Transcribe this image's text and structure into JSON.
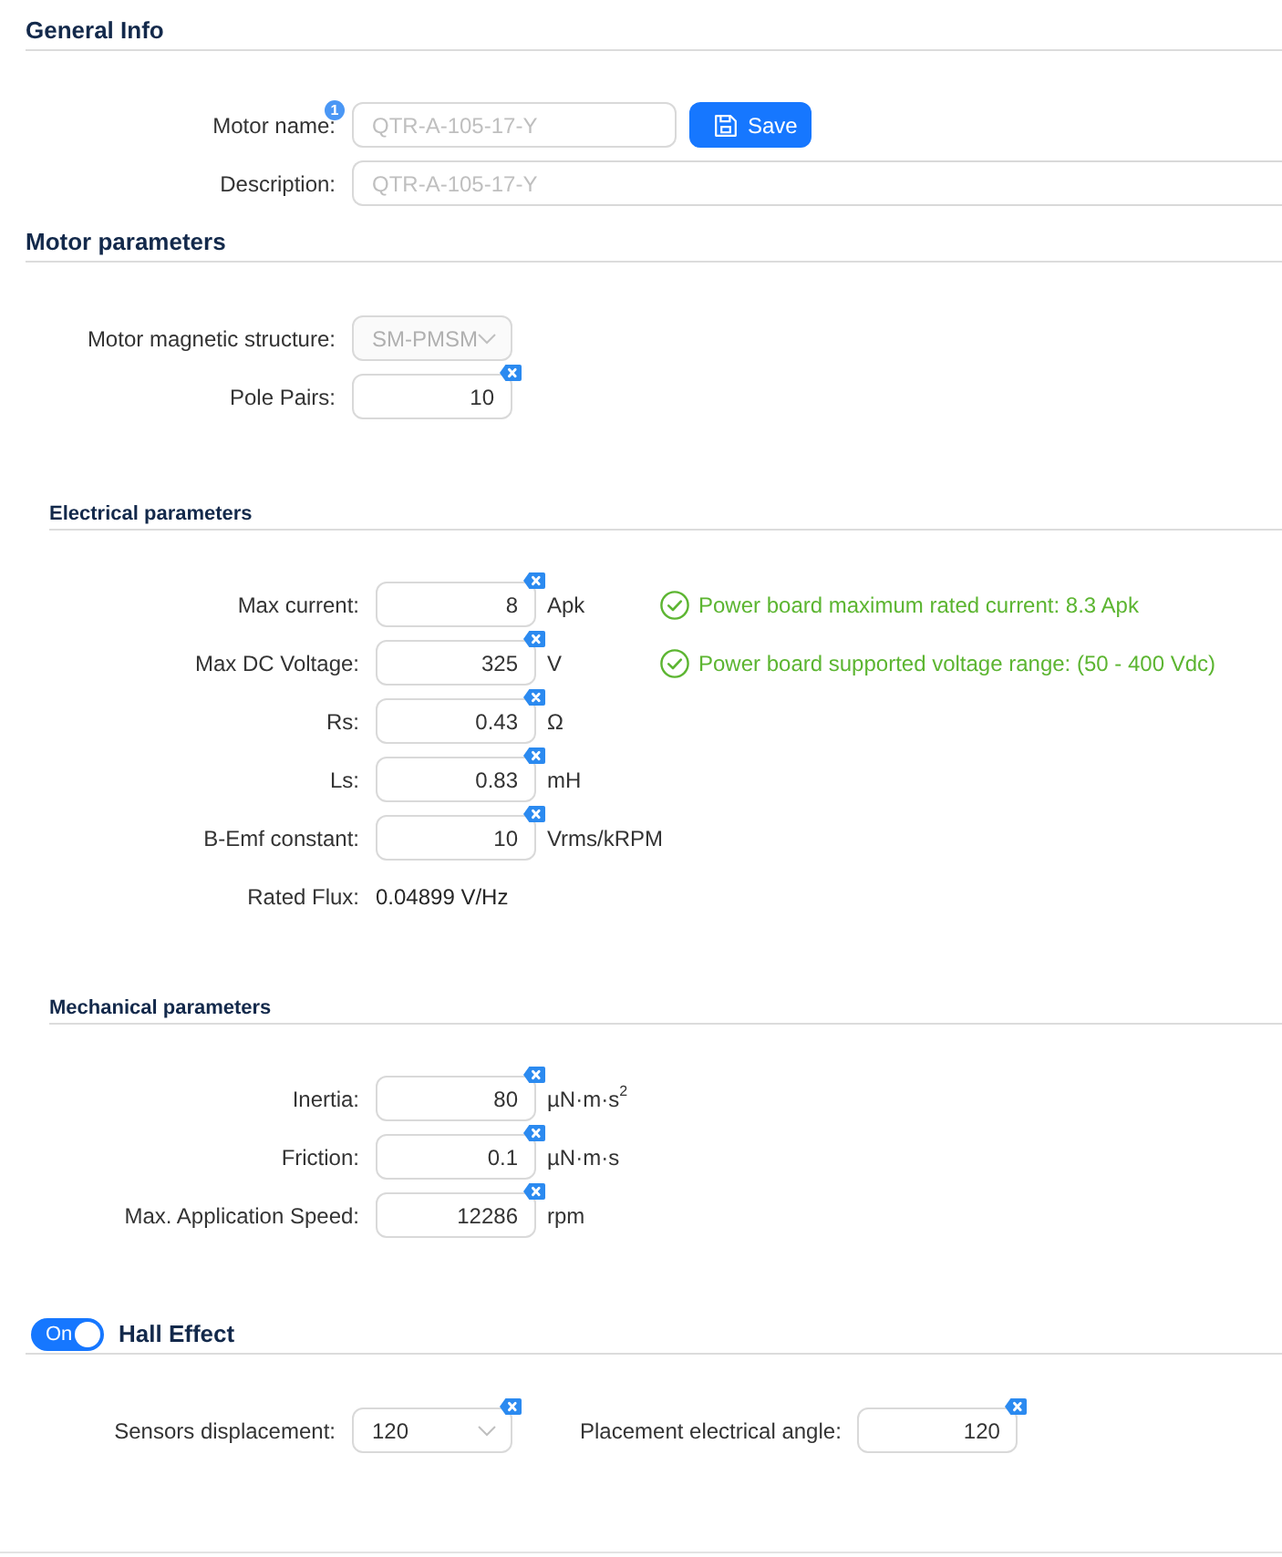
{
  "general_info": {
    "title": "General Info",
    "motor_name": {
      "label": "Motor name:",
      "badge": "1",
      "placeholder": "QTR-A-105-17-Y"
    },
    "save_button": {
      "label": "Save"
    },
    "description": {
      "label": "Description:",
      "placeholder": "QTR-A-105-17-Y"
    }
  },
  "motor_parameters": {
    "title": "Motor parameters",
    "fields": [
      {
        "kind": "select",
        "label": "Motor magnetic structure:",
        "value": "SM-PMSM",
        "disabled": true,
        "clearable": false
      },
      {
        "kind": "number",
        "label": "Pole Pairs:",
        "value": "10",
        "disabled": false,
        "clearable": true
      }
    ]
  },
  "electrical_parameters": {
    "title": "Electrical parameters",
    "fields": [
      {
        "kind": "number",
        "label": "Max current:",
        "value": "8",
        "unit": "Apk",
        "clearable": true,
        "note": "Power board maximum rated current: 8.3 Apk"
      },
      {
        "kind": "number",
        "label": "Max DC Voltage:",
        "value": "325",
        "unit": "V",
        "clearable": true,
        "note": "Power board supported voltage range: (50 - 400 Vdc)"
      },
      {
        "kind": "number",
        "label": "Rs:",
        "value": "0.43",
        "unit": "Ω",
        "clearable": true
      },
      {
        "kind": "number",
        "label": "Ls:",
        "value": "0.83",
        "unit": "mH",
        "clearable": true
      },
      {
        "kind": "number",
        "label": "B-Emf constant:",
        "value": "10",
        "unit": "Vrms/kRPM",
        "clearable": true
      },
      {
        "kind": "readout",
        "label": "Rated Flux:",
        "value": "0.04899 V/Hz",
        "clearable": false
      }
    ]
  },
  "mechanical_parameters": {
    "title": "Mechanical parameters",
    "fields": [
      {
        "kind": "number",
        "label": "Inertia:",
        "value": "80",
        "unit": "µN·m·s$^{2}$",
        "clearable": true
      },
      {
        "kind": "number",
        "label": "Friction:",
        "value": "0.1",
        "unit": "µN·m·s",
        "clearable": true
      },
      {
        "kind": "number",
        "label": "Max. Application Speed:",
        "value": "12286",
        "unit": "rpm",
        "clearable": true
      }
    ]
  },
  "hall_effect": {
    "title": "Hall Effect",
    "toggle": {
      "label": "On",
      "on": true
    },
    "fields": [
      {
        "kind": "select",
        "label": "Sensors displacement:",
        "value": "120",
        "clearable": true
      },
      {
        "kind": "number",
        "label": "Placement electrical angle:",
        "value": "120",
        "clearable": true
      }
    ]
  }
}
